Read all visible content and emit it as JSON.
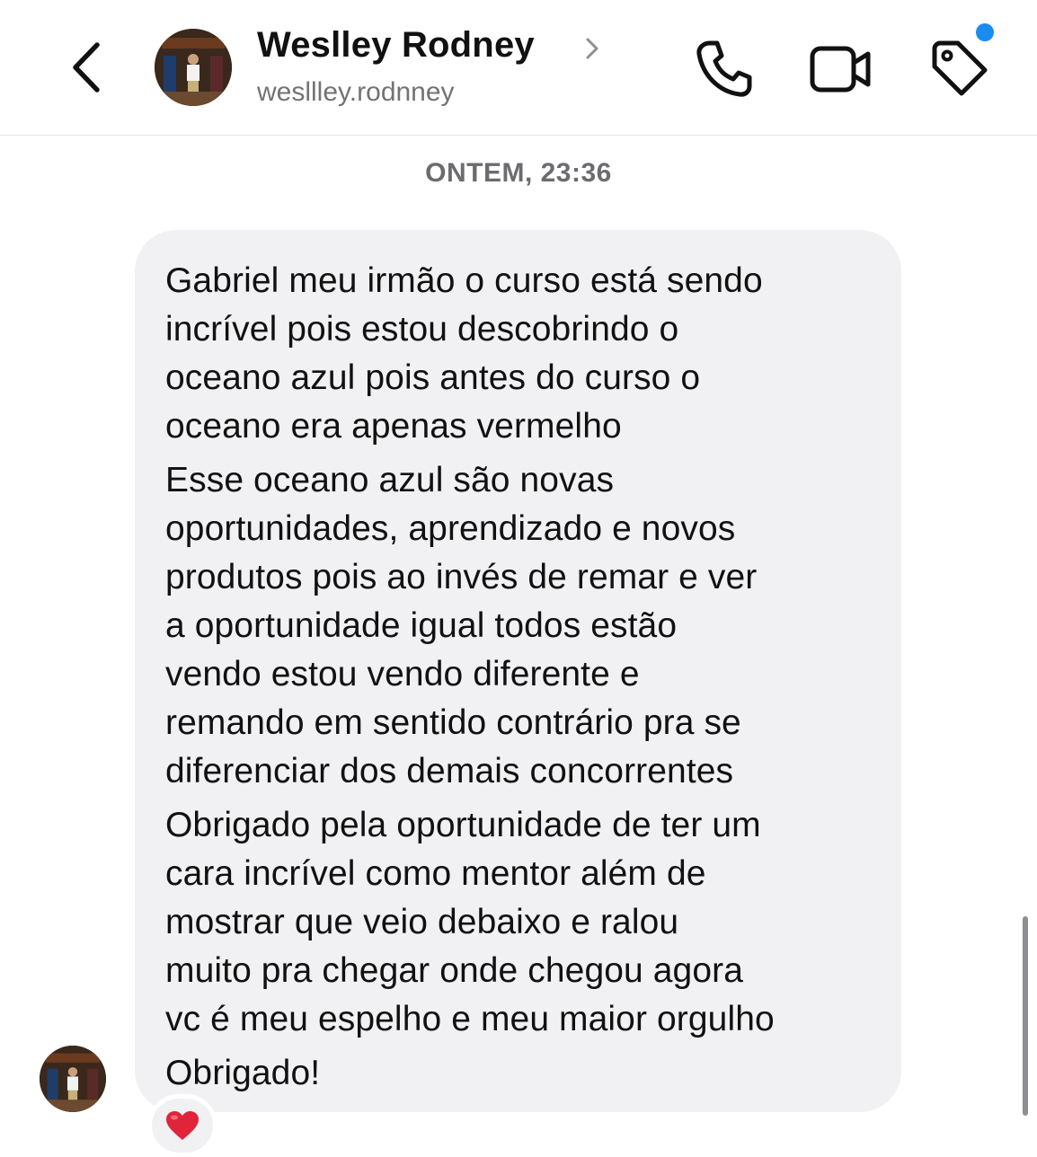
{
  "header": {
    "contact_name": "Weslley Rodney",
    "contact_handle": "wesllley.rodnney",
    "icons": {
      "back": "chevron-left-icon",
      "profile": "chevron-right-icon",
      "call": "phone-icon",
      "video": "video-camera-icon",
      "tag": "tag-icon"
    },
    "unread_dot_color": "#1a8cf0"
  },
  "thread": {
    "timestamp": "ONTEM, 23:36",
    "message": {
      "paragraphs": [
        "Gabriel meu irmão o curso está sendo\nincrível pois estou descobrindo o\noceano azul pois antes do curso o\noceano era apenas vermelho",
        "Esse oceano azul são novas\noportunidades, aprendizado e novos\nprodutos pois ao invés de remar e ver\na oportunidade igual todos estão\nvendo estou vendo diferente e\nremando em sentido contrário pra se\ndiferenciar dos demais concorrentes",
        "Obrigado pela oportunidade de ter um\ncara incrível como mentor além de\nmostrar que veio debaixo e ralou\nmuito pra chegar onde chegou agora\nvc é meu espelho e meu maior orgulho",
        "Obrigado!"
      ],
      "reaction": "❤️"
    }
  },
  "colors": {
    "bubble_bg": "#f1f1f3",
    "heart": "#e0243a",
    "secondary_text": "#737373"
  }
}
